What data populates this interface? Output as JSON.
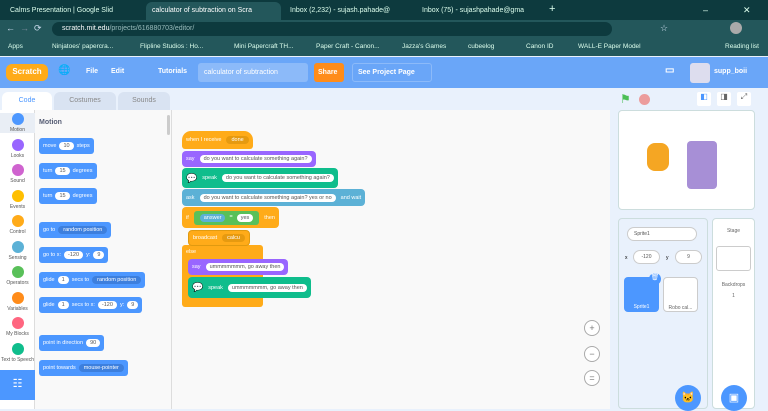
{
  "browser": {
    "tabs": [
      "Calms Presentation | Google Slid",
      "calculator of subtraction on Scra",
      "Inbox (2,232) - sujash.pahade@",
      "Inbox (75) - sujashpahade@gma"
    ],
    "url_host": "scratch.mit.edu",
    "url_path": "/projects/616880703/editor/",
    "bookmarks": [
      "Apps",
      "Ninjatoes' papercra...",
      "Flipline Studios : Ho...",
      "Mini Papercraft TH...",
      "Paper Craft - Canon...",
      "Jazza's Games",
      "cubeelog",
      "Canon ID",
      "WALL-E Paper Model"
    ],
    "reading_list": "Reading list"
  },
  "menu": {
    "logo": "Scratch",
    "file": "File",
    "edit": "Edit",
    "tutorials": "Tutorials",
    "project_title": "calculator of subtraction",
    "share": "Share",
    "see_project": "See Project Page",
    "user": "supp_boii"
  },
  "editor_tabs": [
    "Code",
    "Costumes",
    "Sounds"
  ],
  "categories": [
    {
      "label": "Motion",
      "color": "#4c97ff"
    },
    {
      "label": "Looks",
      "color": "#9966ff"
    },
    {
      "label": "Sound",
      "color": "#cf63cf"
    },
    {
      "label": "Events",
      "color": "#ffbf00"
    },
    {
      "label": "Control",
      "color": "#ffab19"
    },
    {
      "label": "Sensing",
      "color": "#5cb1d6"
    },
    {
      "label": "Operators",
      "color": "#59c059"
    },
    {
      "label": "Variables",
      "color": "#ff8c1a"
    },
    {
      "label": "My Blocks",
      "color": "#ff6680"
    },
    {
      "label": "Text to Speech",
      "color": "#0fbd8c"
    }
  ],
  "palette": {
    "heading": "Motion",
    "move": [
      "move",
      "10",
      "steps"
    ],
    "turn_right": [
      "turn",
      "15",
      "degrees"
    ],
    "turn_left": [
      "turn",
      "15",
      "degrees"
    ],
    "goto": [
      "go to",
      "random position"
    ],
    "gotoxy": [
      "go to x:",
      "-120",
      "y:",
      "9"
    ],
    "glide": [
      "glide",
      "1",
      "secs to",
      "random position"
    ],
    "glidexy": [
      "glide",
      "1",
      "secs to x:",
      "-120",
      "y:",
      "9"
    ],
    "point_dir": [
      "point in direction",
      "90"
    ],
    "point_towards": [
      "point towards",
      "mouse-pointer"
    ]
  },
  "script": {
    "hat": [
      "when I receive",
      "done"
    ],
    "say1": [
      "say",
      "do you want to calculate something again?"
    ],
    "speak1": [
      "speak",
      "do you want to calculate something again?"
    ],
    "ask": [
      "ask",
      "do you want to calculate something again? yes or no",
      "and wait"
    ],
    "if": [
      "if",
      "answer",
      "=",
      "yes",
      "then"
    ],
    "broadcast": [
      "broadcast",
      "calcu"
    ],
    "else": "else",
    "say2": [
      "say",
      "ummmmmmm, go away then"
    ],
    "speak2": [
      "speak",
      "ummmmmmm, go away then"
    ]
  },
  "sprite_info": {
    "name": "Sprite1",
    "x_label": "x",
    "x": "-120",
    "y_label": "y",
    "y": "9"
  },
  "sprites": [
    "Sprite1",
    "Robo cal..."
  ],
  "stage_pane": {
    "title": "Stage",
    "backdrops_label": "Backdrops",
    "backdrops_count": "1"
  }
}
